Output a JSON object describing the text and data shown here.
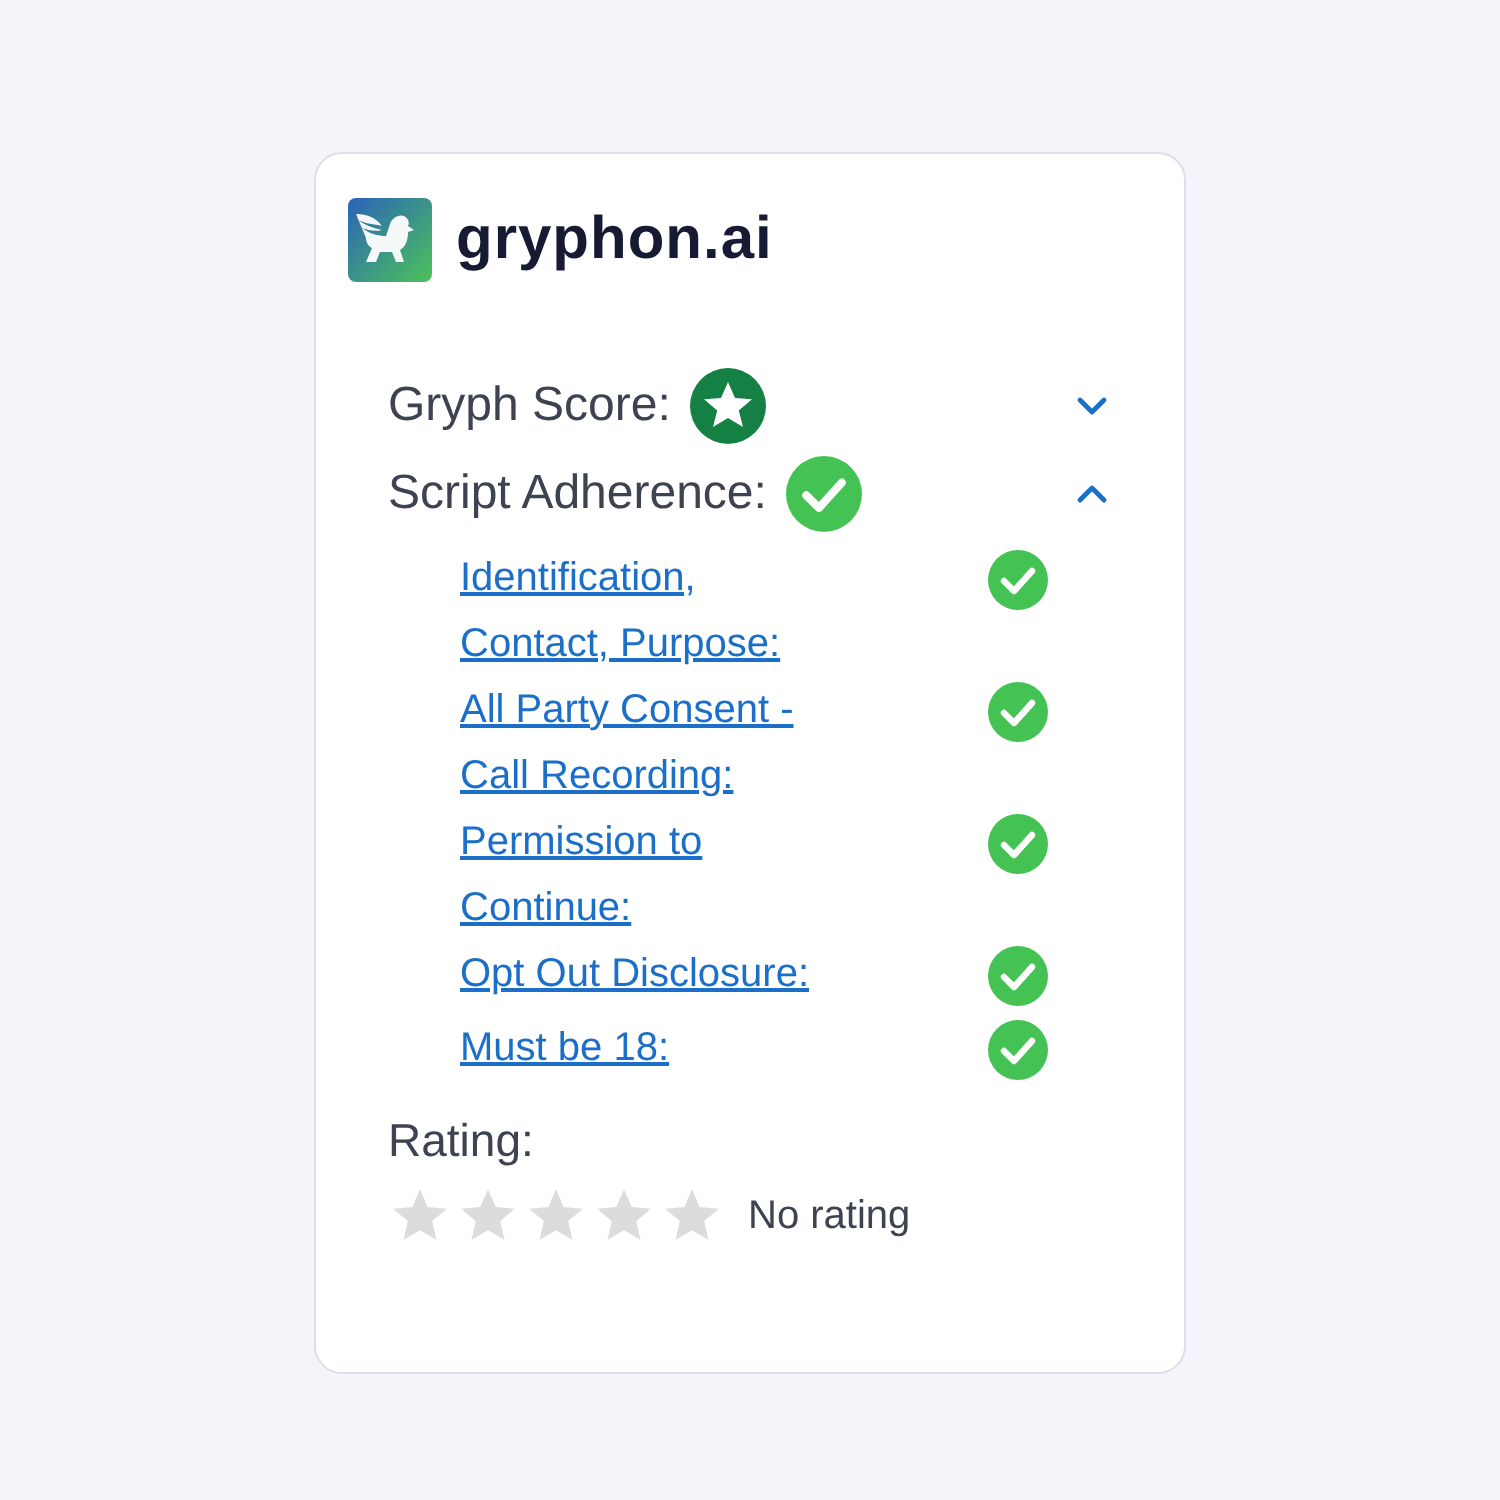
{
  "brand": {
    "name": "gryphon.ai"
  },
  "sections": [
    {
      "label": "Gryph Score:",
      "kind": "score",
      "expanded": false
    },
    {
      "label": "Script Adherence:",
      "kind": "check",
      "expanded": true,
      "items": [
        {
          "label": "Identification, Contact, Purpose:",
          "passed": true
        },
        {
          "label": "All Party Consent - Call Recording:",
          "passed": true
        },
        {
          "label": "Permission to Continue:",
          "passed": true
        },
        {
          "label": "Opt Out Disclosure:",
          "passed": true
        },
        {
          "label": "Must be 18:",
          "passed": true
        }
      ]
    }
  ],
  "rating": {
    "label": "Rating:",
    "stars": 0,
    "text": "No rating"
  }
}
